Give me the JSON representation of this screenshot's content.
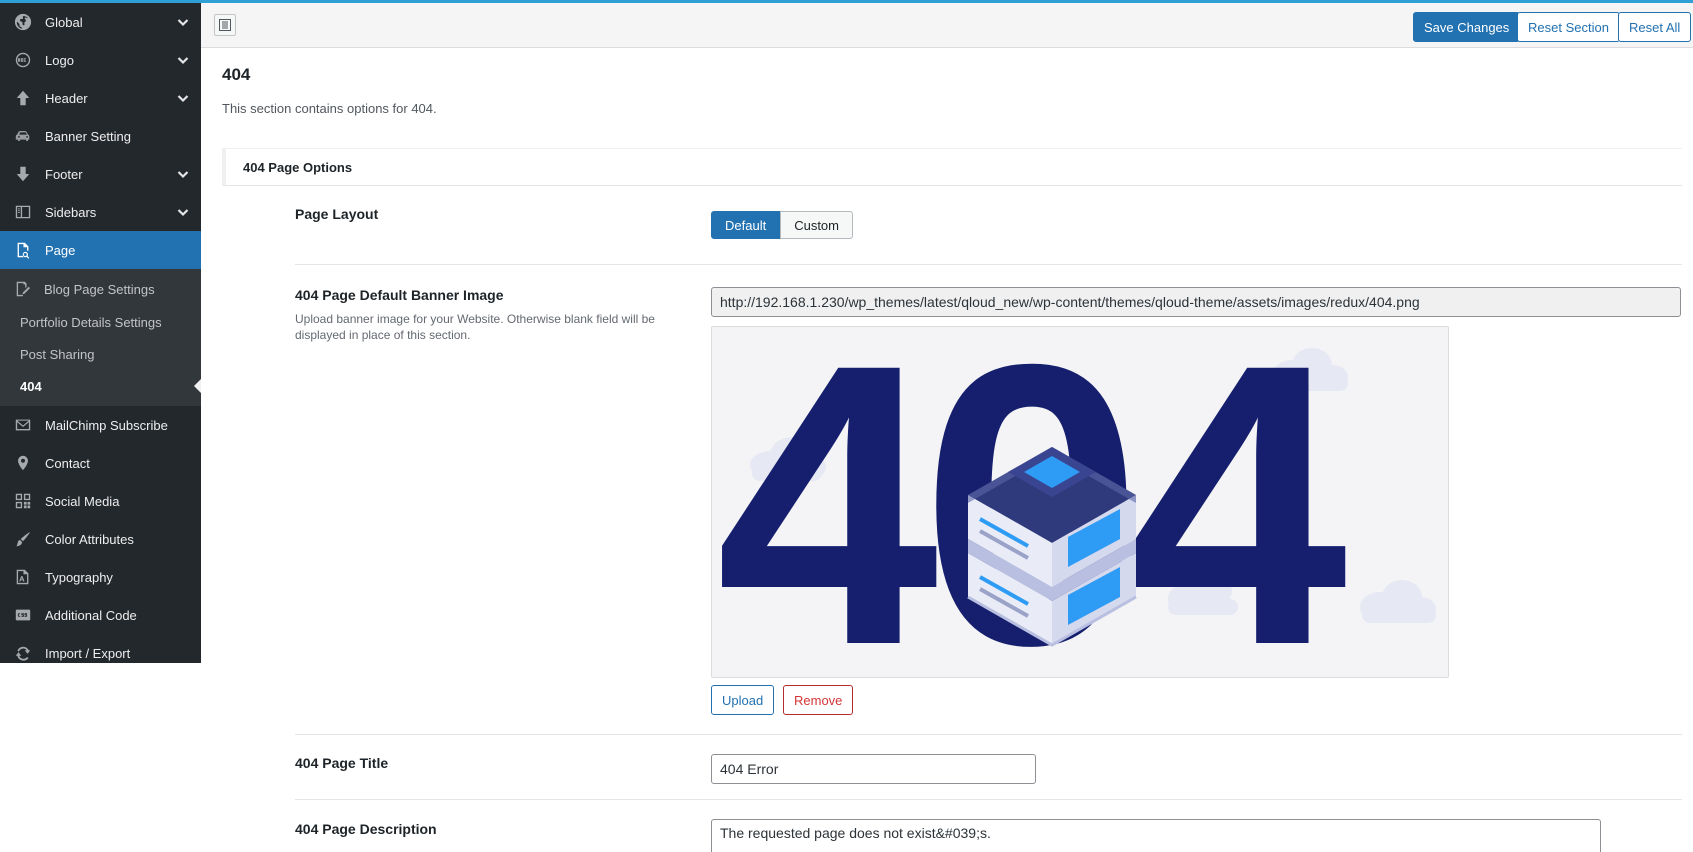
{
  "sidebar": {
    "items": [
      {
        "label": "Global",
        "icon": "globe-icon",
        "chevron": true
      },
      {
        "label": "Logo",
        "icon": "logo-icon",
        "chevron": true
      },
      {
        "label": "Header",
        "icon": "arrow-up-icon",
        "chevron": true
      },
      {
        "label": "Banner Setting",
        "icon": "car-icon",
        "chevron": false
      },
      {
        "label": "Footer",
        "icon": "arrow-down-icon",
        "chevron": true
      },
      {
        "label": "Sidebars",
        "icon": "layout-icon",
        "chevron": true
      },
      {
        "label": "Page",
        "icon": "page-search-icon",
        "chevron": false
      }
    ],
    "sub_items": [
      {
        "label": "Blog Page Settings"
      },
      {
        "label": "Portfolio Details Settings"
      },
      {
        "label": "Post Sharing"
      },
      {
        "label": "404"
      }
    ],
    "items_after": [
      {
        "label": "MailChimp Subscribe",
        "icon": "envelope-icon"
      },
      {
        "label": "Contact",
        "icon": "location-pin-icon"
      },
      {
        "label": "Social Media",
        "icon": "grid-share-icon"
      },
      {
        "label": "Color Attributes",
        "icon": "brush-icon"
      },
      {
        "label": "Typography",
        "icon": "typography-icon"
      },
      {
        "label": "Additional Code",
        "icon": "css-icon"
      },
      {
        "label": "Import / Export",
        "icon": "refresh-icon"
      }
    ]
  },
  "toolbar": {
    "save_label": "Save Changes",
    "reset_section_label": "Reset Section",
    "reset_all_label": "Reset All"
  },
  "section": {
    "title": "404",
    "description": "This section contains options for 404.",
    "group_title": "404 Page Options"
  },
  "fields": {
    "layout": {
      "label": "Page Layout",
      "options": [
        "Default",
        "Custom"
      ],
      "selected": "Default"
    },
    "banner": {
      "label": "404 Page Default Banner Image",
      "description": "Upload banner image for your Website. Otherwise blank field will be displayed in place of this section.",
      "url": "http://192.168.1.230/wp_themes/latest/qloud_new/wp-content/themes/qloud-theme/assets/images/redux/404.png",
      "upload_label": "Upload",
      "remove_label": "Remove",
      "image_text": "404"
    },
    "title": {
      "label": "404 Page Title",
      "value": "404 Error"
    },
    "description": {
      "label": "404 Page Description",
      "value": "The requested page does not exist&#039;s."
    }
  },
  "colors": {
    "accent": "#2271b1",
    "sidebar_bg": "#23282d",
    "sub_menu_bg": "#32373c",
    "image_navy": "#151f6d",
    "image_blue": "#2e9bf5"
  }
}
